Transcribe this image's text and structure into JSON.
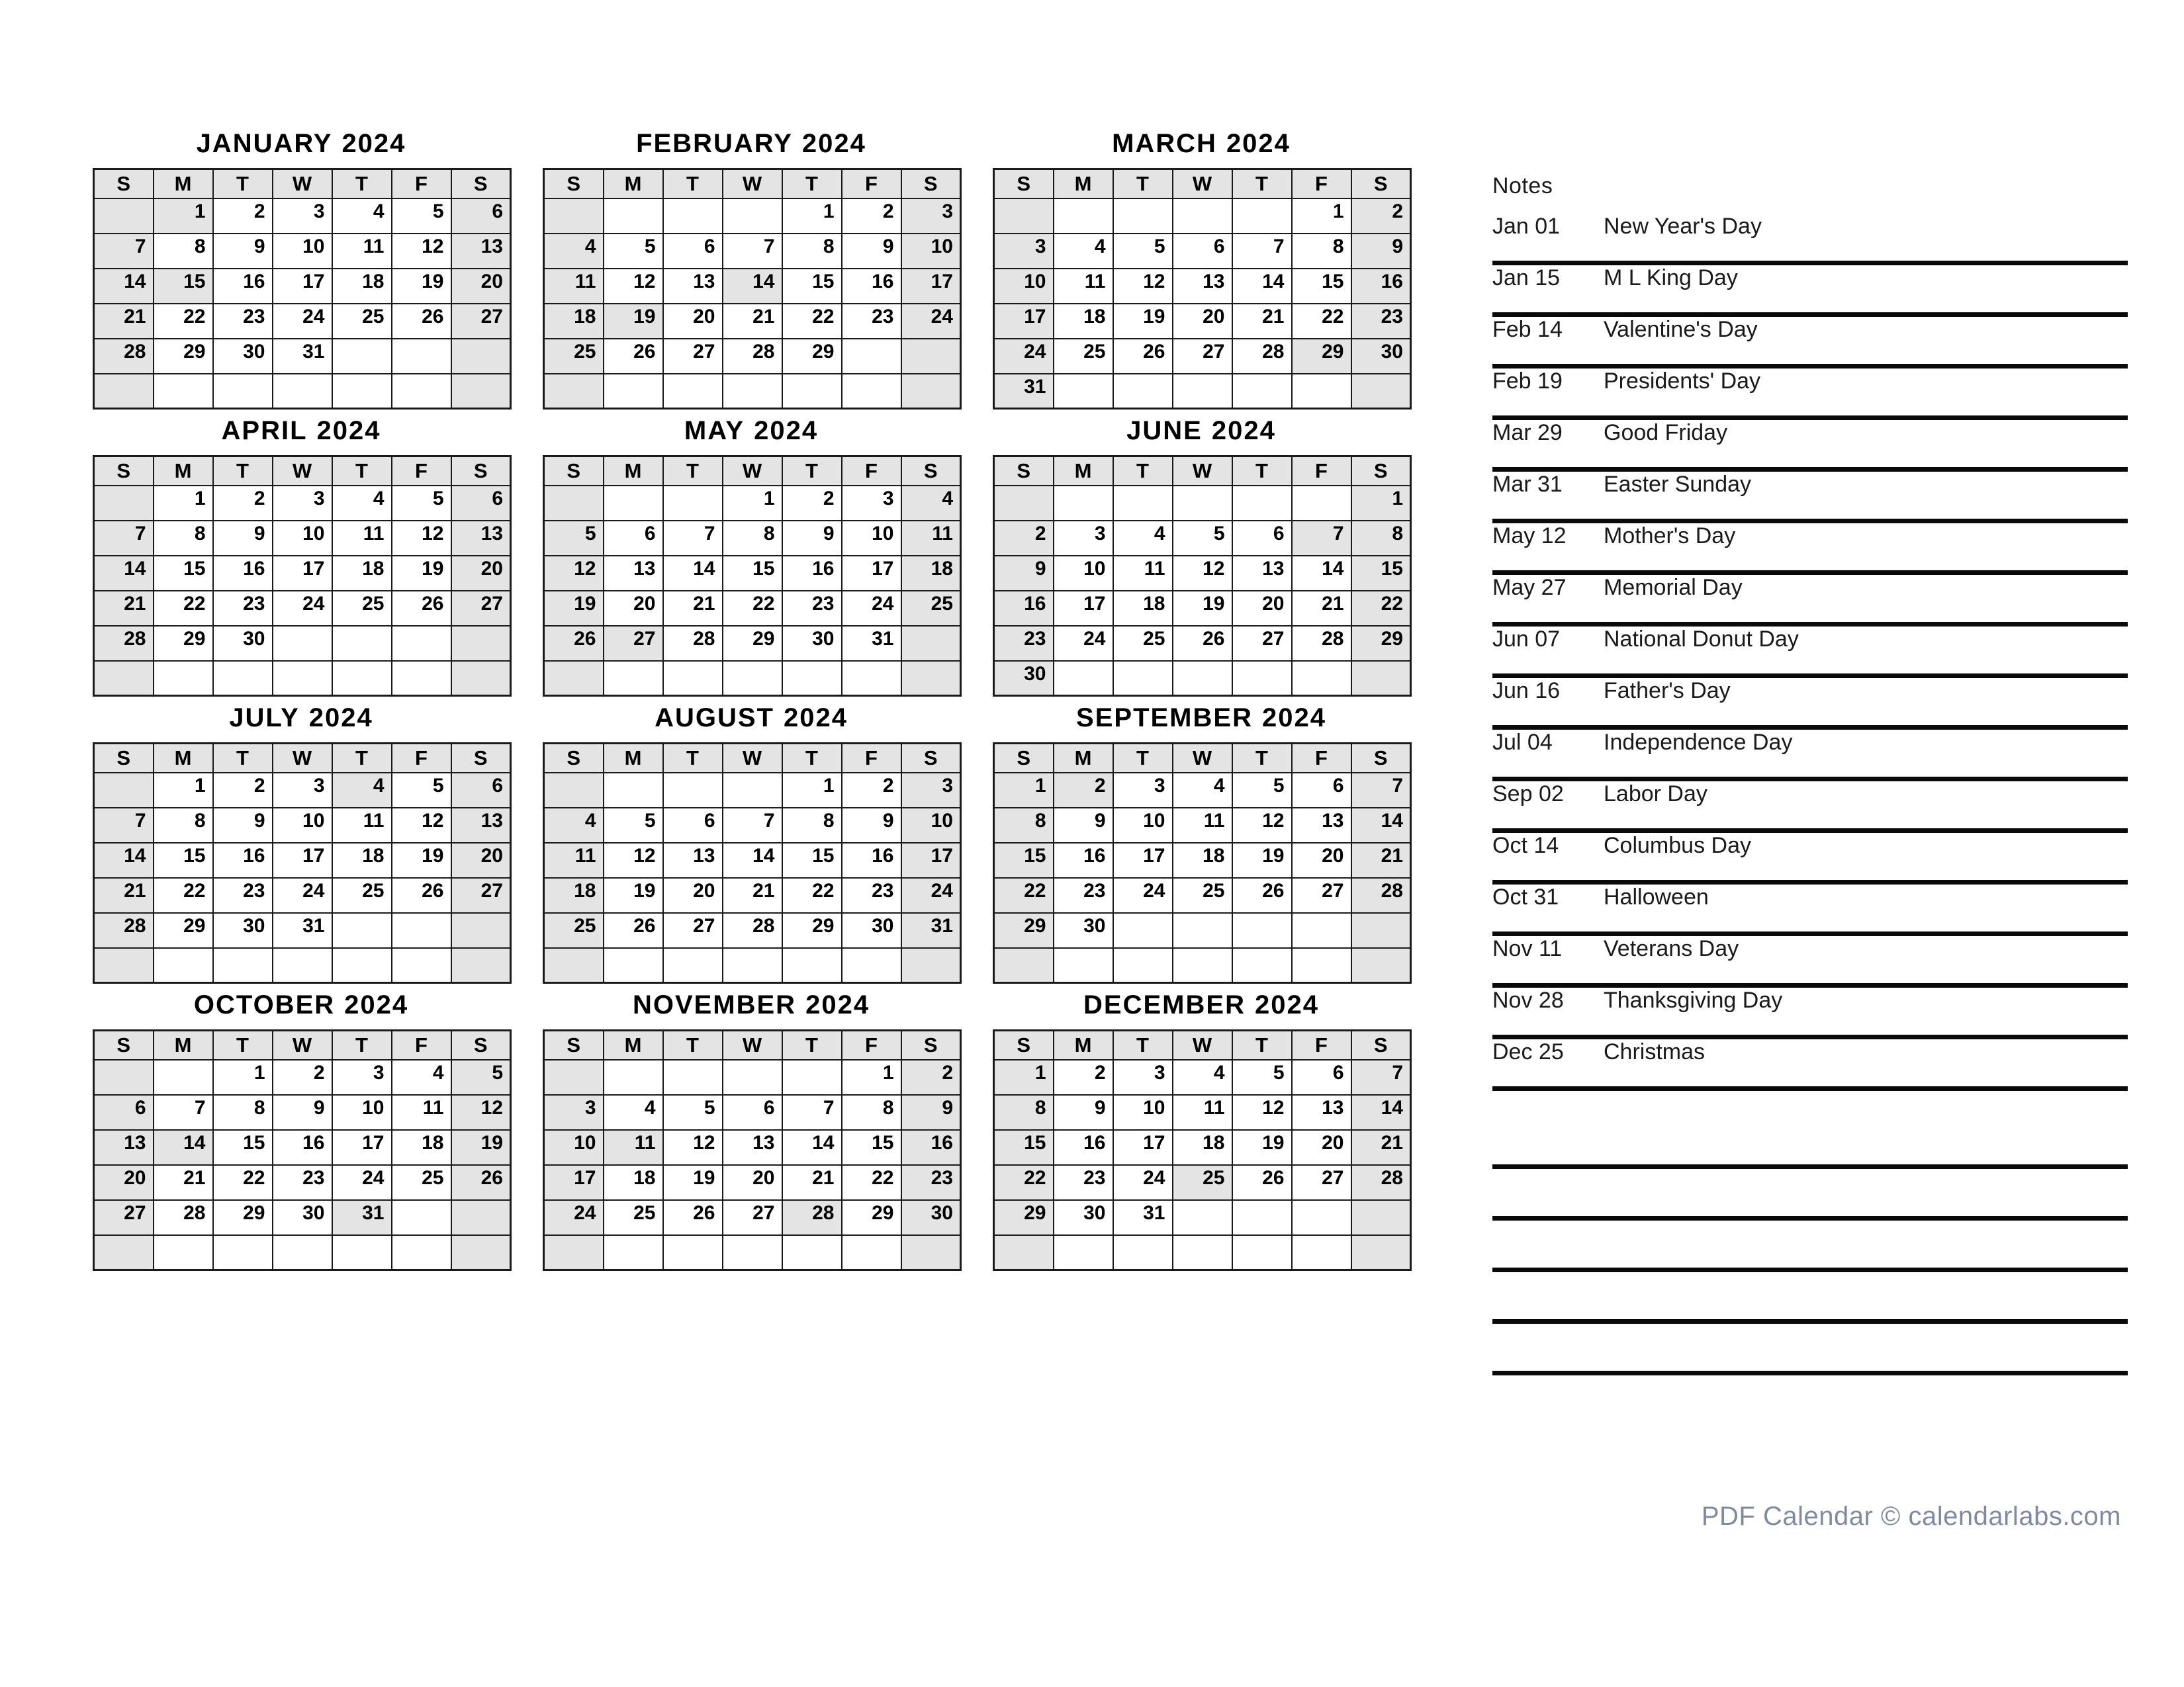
{
  "year": "2024",
  "day_headers": [
    "S",
    "M",
    "T",
    "W",
    "T",
    "F",
    "S"
  ],
  "notes": {
    "heading": "Notes",
    "items": [
      {
        "date": "Jan 01",
        "label": "New Year's Day"
      },
      {
        "date": "Jan 15",
        "label": "M L King Day"
      },
      {
        "date": "Feb 14",
        "label": "Valentine's Day"
      },
      {
        "date": "Feb 19",
        "label": "Presidents' Day"
      },
      {
        "date": "Mar 29",
        "label": "Good Friday"
      },
      {
        "date": "Mar 31",
        "label": "Easter Sunday"
      },
      {
        "date": "May 12",
        "label": "Mother's Day"
      },
      {
        "date": "May 27",
        "label": "Memorial Day"
      },
      {
        "date": "Jun 07",
        "label": "National Donut Day"
      },
      {
        "date": "Jun 16",
        "label": "Father's Day"
      },
      {
        "date": "Jul 04",
        "label": "Independence Day"
      },
      {
        "date": "Sep 02",
        "label": "Labor Day"
      },
      {
        "date": "Oct 14",
        "label": "Columbus Day"
      },
      {
        "date": "Oct 31",
        "label": "Halloween"
      },
      {
        "date": "Nov 11",
        "label": "Veterans Day"
      },
      {
        "date": "Nov 28",
        "label": "Thanksgiving Day"
      },
      {
        "date": "Dec 25",
        "label": "Christmas"
      }
    ],
    "blank_line_count": 5
  },
  "footer": {
    "text": "PDF Calendar © calendarlabs.com"
  },
  "colors": {
    "shade": "#e4e4e4",
    "border": "#1a1a1a",
    "text": "#000000",
    "footer_text": "#7f8aa0"
  },
  "months": [
    {
      "name": "JANUARY",
      "title": "JANUARY 2024",
      "first_weekday": 1,
      "days_in_month": 31,
      "holidays": [
        1,
        15
      ],
      "weeks": [
        [
          "",
          "1",
          "2",
          "3",
          "4",
          "5",
          "6"
        ],
        [
          "7",
          "8",
          "9",
          "10",
          "11",
          "12",
          "13"
        ],
        [
          "14",
          "15",
          "16",
          "17",
          "18",
          "19",
          "20"
        ],
        [
          "21",
          "22",
          "23",
          "24",
          "25",
          "26",
          "27"
        ],
        [
          "28",
          "29",
          "30",
          "31",
          "",
          "",
          ""
        ],
        [
          "",
          "",
          "",
          "",
          "",
          "",
          ""
        ]
      ]
    },
    {
      "name": "FEBRUARY",
      "title": "FEBRUARY 2024",
      "first_weekday": 4,
      "days_in_month": 29,
      "holidays": [
        14,
        19
      ],
      "weeks": [
        [
          "",
          "",
          "",
          "",
          "1",
          "2",
          "3"
        ],
        [
          "4",
          "5",
          "6",
          "7",
          "8",
          "9",
          "10"
        ],
        [
          "11",
          "12",
          "13",
          "14",
          "15",
          "16",
          "17"
        ],
        [
          "18",
          "19",
          "20",
          "21",
          "22",
          "23",
          "24"
        ],
        [
          "25",
          "26",
          "27",
          "28",
          "29",
          "",
          ""
        ],
        [
          "",
          "",
          "",
          "",
          "",
          "",
          ""
        ]
      ]
    },
    {
      "name": "MARCH",
      "title": "MARCH 2024",
      "first_weekday": 5,
      "days_in_month": 31,
      "holidays": [
        29
      ],
      "weeks": [
        [
          "",
          "",
          "",
          "",
          "",
          "1",
          "2"
        ],
        [
          "3",
          "4",
          "5",
          "6",
          "7",
          "8",
          "9"
        ],
        [
          "10",
          "11",
          "12",
          "13",
          "14",
          "15",
          "16"
        ],
        [
          "17",
          "18",
          "19",
          "20",
          "21",
          "22",
          "23"
        ],
        [
          "24",
          "25",
          "26",
          "27",
          "28",
          "29",
          "30"
        ],
        [
          "31",
          "",
          "",
          "",
          "",
          "",
          ""
        ]
      ]
    },
    {
      "name": "APRIL",
      "title": "APRIL 2024",
      "first_weekday": 1,
      "days_in_month": 30,
      "holidays": [],
      "weeks": [
        [
          "",
          "1",
          "2",
          "3",
          "4",
          "5",
          "6"
        ],
        [
          "7",
          "8",
          "9",
          "10",
          "11",
          "12",
          "13"
        ],
        [
          "14",
          "15",
          "16",
          "17",
          "18",
          "19",
          "20"
        ],
        [
          "21",
          "22",
          "23",
          "24",
          "25",
          "26",
          "27"
        ],
        [
          "28",
          "29",
          "30",
          "",
          "",
          "",
          ""
        ],
        [
          "",
          "",
          "",
          "",
          "",
          "",
          ""
        ]
      ]
    },
    {
      "name": "MAY",
      "title": "MAY 2024",
      "first_weekday": 3,
      "days_in_month": 31,
      "holidays": [
        27
      ],
      "weeks": [
        [
          "",
          "",
          "",
          "1",
          "2",
          "3",
          "4"
        ],
        [
          "5",
          "6",
          "7",
          "8",
          "9",
          "10",
          "11"
        ],
        [
          "12",
          "13",
          "14",
          "15",
          "16",
          "17",
          "18"
        ],
        [
          "19",
          "20",
          "21",
          "22",
          "23",
          "24",
          "25"
        ],
        [
          "26",
          "27",
          "28",
          "29",
          "30",
          "31",
          ""
        ],
        [
          "",
          "",
          "",
          "",
          "",
          "",
          ""
        ]
      ]
    },
    {
      "name": "JUNE",
      "title": "JUNE 2024",
      "first_weekday": 6,
      "days_in_month": 30,
      "holidays": [
        7
      ],
      "weeks": [
        [
          "",
          "",
          "",
          "",
          "",
          "",
          "1"
        ],
        [
          "2",
          "3",
          "4",
          "5",
          "6",
          "7",
          "8"
        ],
        [
          "9",
          "10",
          "11",
          "12",
          "13",
          "14",
          "15"
        ],
        [
          "16",
          "17",
          "18",
          "19",
          "20",
          "21",
          "22"
        ],
        [
          "23",
          "24",
          "25",
          "26",
          "27",
          "28",
          "29"
        ],
        [
          "30",
          "",
          "",
          "",
          "",
          "",
          ""
        ]
      ]
    },
    {
      "name": "JULY",
      "title": "JULY 2024",
      "first_weekday": 1,
      "days_in_month": 31,
      "holidays": [
        4
      ],
      "weeks": [
        [
          "",
          "1",
          "2",
          "3",
          "4",
          "5",
          "6"
        ],
        [
          "7",
          "8",
          "9",
          "10",
          "11",
          "12",
          "13"
        ],
        [
          "14",
          "15",
          "16",
          "17",
          "18",
          "19",
          "20"
        ],
        [
          "21",
          "22",
          "23",
          "24",
          "25",
          "26",
          "27"
        ],
        [
          "28",
          "29",
          "30",
          "31",
          "",
          "",
          ""
        ],
        [
          "",
          "",
          "",
          "",
          "",
          "",
          ""
        ]
      ]
    },
    {
      "name": "AUGUST",
      "title": "AUGUST 2024",
      "first_weekday": 4,
      "days_in_month": 31,
      "holidays": [],
      "weeks": [
        [
          "",
          "",
          "",
          "",
          "1",
          "2",
          "3"
        ],
        [
          "4",
          "5",
          "6",
          "7",
          "8",
          "9",
          "10"
        ],
        [
          "11",
          "12",
          "13",
          "14",
          "15",
          "16",
          "17"
        ],
        [
          "18",
          "19",
          "20",
          "21",
          "22",
          "23",
          "24"
        ],
        [
          "25",
          "26",
          "27",
          "28",
          "29",
          "30",
          "31"
        ],
        [
          "",
          "",
          "",
          "",
          "",
          "",
          ""
        ]
      ]
    },
    {
      "name": "SEPTEMBER",
      "title": "SEPTEMBER 2024",
      "first_weekday": 0,
      "days_in_month": 30,
      "holidays": [
        2
      ],
      "weeks": [
        [
          "1",
          "2",
          "3",
          "4",
          "5",
          "6",
          "7"
        ],
        [
          "8",
          "9",
          "10",
          "11",
          "12",
          "13",
          "14"
        ],
        [
          "15",
          "16",
          "17",
          "18",
          "19",
          "20",
          "21"
        ],
        [
          "22",
          "23",
          "24",
          "25",
          "26",
          "27",
          "28"
        ],
        [
          "29",
          "30",
          "",
          "",
          "",
          "",
          ""
        ],
        [
          "",
          "",
          "",
          "",
          "",
          "",
          ""
        ]
      ]
    },
    {
      "name": "OCTOBER",
      "title": "OCTOBER 2024",
      "first_weekday": 2,
      "days_in_month": 31,
      "holidays": [
        14,
        31
      ],
      "weeks": [
        [
          "",
          "",
          "1",
          "2",
          "3",
          "4",
          "5"
        ],
        [
          "6",
          "7",
          "8",
          "9",
          "10",
          "11",
          "12"
        ],
        [
          "13",
          "14",
          "15",
          "16",
          "17",
          "18",
          "19"
        ],
        [
          "20",
          "21",
          "22",
          "23",
          "24",
          "25",
          "26"
        ],
        [
          "27",
          "28",
          "29",
          "30",
          "31",
          "",
          ""
        ],
        [
          "",
          "",
          "",
          "",
          "",
          "",
          ""
        ]
      ]
    },
    {
      "name": "NOVEMBER",
      "title": "NOVEMBER 2024",
      "first_weekday": 5,
      "days_in_month": 30,
      "holidays": [
        11,
        28
      ],
      "weeks": [
        [
          "",
          "",
          "",
          "",
          "",
          "1",
          "2"
        ],
        [
          "3",
          "4",
          "5",
          "6",
          "7",
          "8",
          "9"
        ],
        [
          "10",
          "11",
          "12",
          "13",
          "14",
          "15",
          "16"
        ],
        [
          "17",
          "18",
          "19",
          "20",
          "21",
          "22",
          "23"
        ],
        [
          "24",
          "25",
          "26",
          "27",
          "28",
          "29",
          "30"
        ],
        [
          "",
          "",
          "",
          "",
          "",
          "",
          ""
        ]
      ]
    },
    {
      "name": "DECEMBER",
      "title": "DECEMBER 2024",
      "first_weekday": 0,
      "days_in_month": 31,
      "holidays": [
        25
      ],
      "weeks": [
        [
          "1",
          "2",
          "3",
          "4",
          "5",
          "6",
          "7"
        ],
        [
          "8",
          "9",
          "10",
          "11",
          "12",
          "13",
          "14"
        ],
        [
          "15",
          "16",
          "17",
          "18",
          "19",
          "20",
          "21"
        ],
        [
          "22",
          "23",
          "24",
          "25",
          "26",
          "27",
          "28"
        ],
        [
          "29",
          "30",
          "31",
          "",
          "",
          "",
          ""
        ],
        [
          "",
          "",
          "",
          "",
          "",
          "",
          ""
        ]
      ]
    }
  ]
}
